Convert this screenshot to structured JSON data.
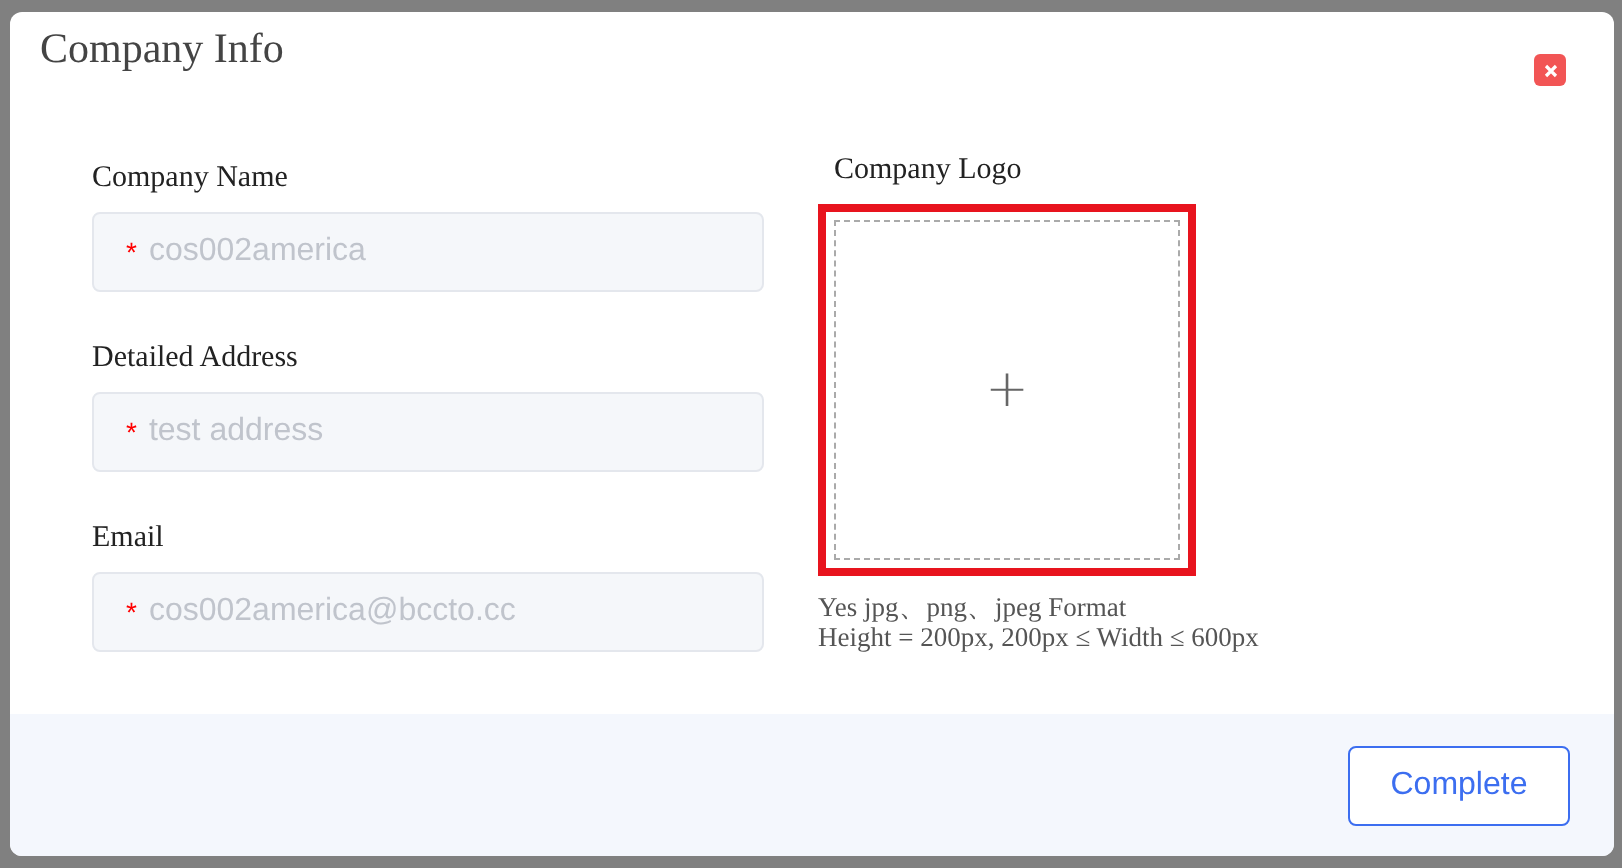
{
  "dialog": {
    "title": "Company Info"
  },
  "fields": [
    {
      "label": "Company Name",
      "required_mark": "*",
      "value": "cos002america",
      "disabled": true
    },
    {
      "label": "Detailed Address",
      "required_mark": "*",
      "value": "test address",
      "disabled": true
    },
    {
      "label": "Email",
      "required_mark": "*",
      "value": "cos002america@bccto.cc",
      "disabled": true
    }
  ],
  "logo": {
    "label": "Company Logo",
    "add_symbol": "+",
    "highlighted": true,
    "hints": [
      "Yes jpg、png、jpeg Format",
      "Height = 200px, 200px ≤ Width ≤ 600px"
    ]
  },
  "buttons": [
    "Complete"
  ]
}
